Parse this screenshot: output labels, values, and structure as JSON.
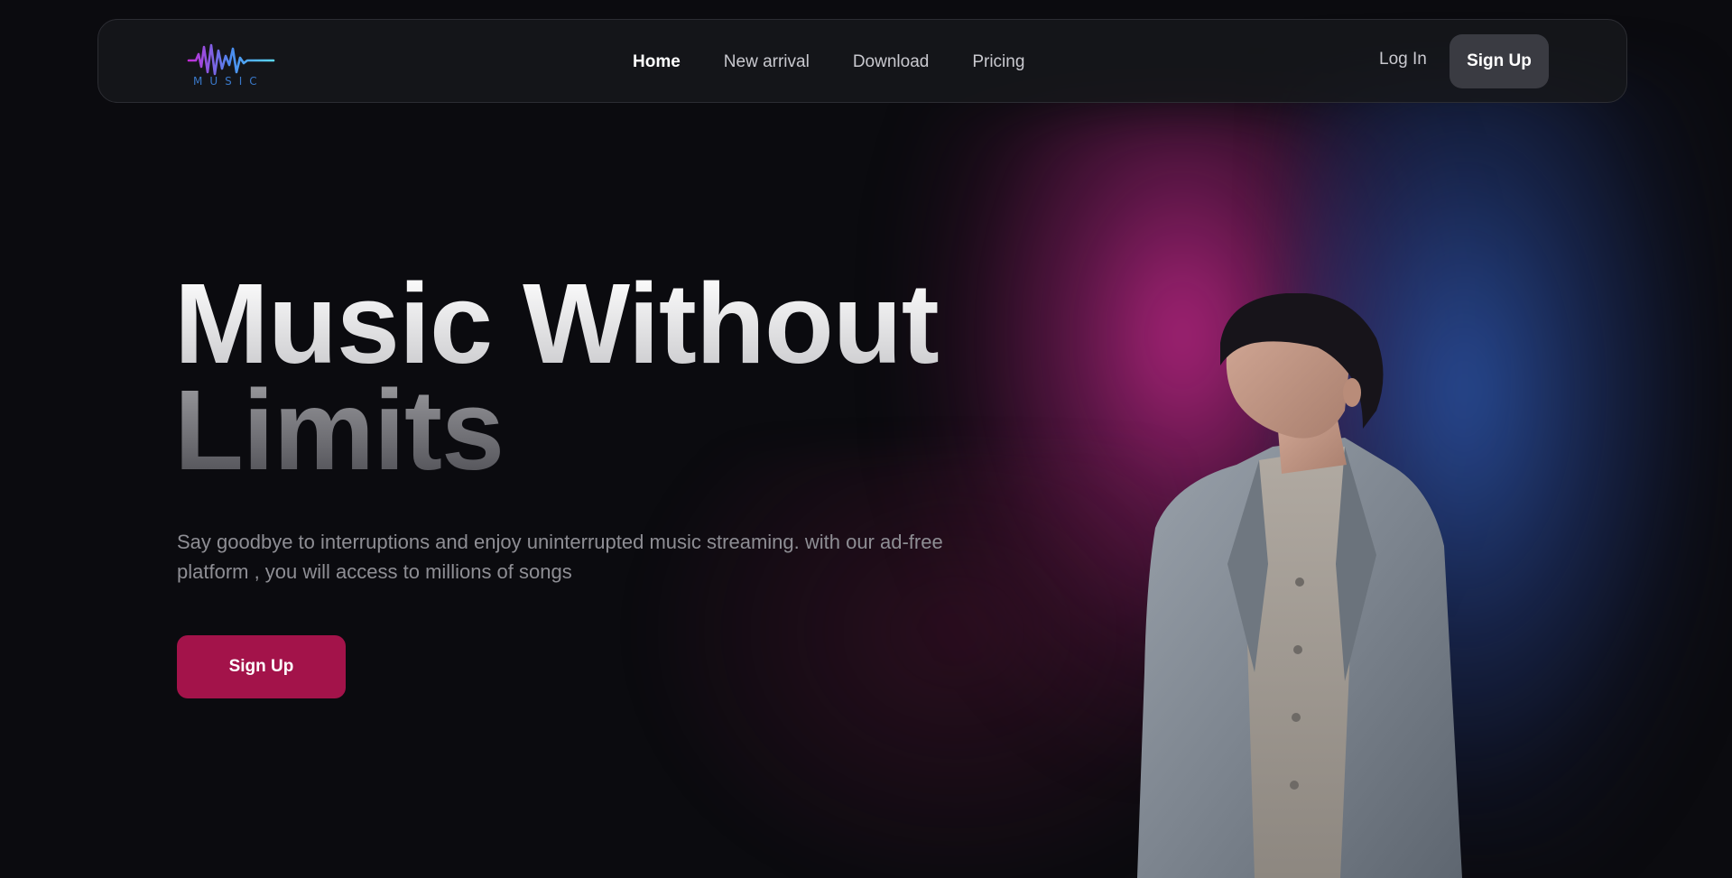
{
  "brand": {
    "logo_text": "MUSIC",
    "logo_colors": [
      "#c42bd6",
      "#4a8cf0",
      "#5ad6f5"
    ]
  },
  "nav": {
    "links": [
      {
        "label": "Home",
        "active": true
      },
      {
        "label": "New arrival",
        "active": false
      },
      {
        "label": "Download",
        "active": false
      },
      {
        "label": "Pricing",
        "active": false
      }
    ],
    "login_label": "Log In",
    "signup_label": "Sign Up"
  },
  "hero": {
    "title_line1": "Music Without",
    "title_line2": "Limits",
    "subtitle": "Say goodbye to interruptions and enjoy uninterrupted music streaming. with our ad-free platform , you will access to millions of songs",
    "cta_label": "Sign Up",
    "cta_color": "#a3134a",
    "image_semantic": "man-in-gray-suit-photo"
  },
  "colors": {
    "background": "#0b0b0f",
    "glow_pink": "#c6288c",
    "glow_blue": "#2d55aa"
  }
}
